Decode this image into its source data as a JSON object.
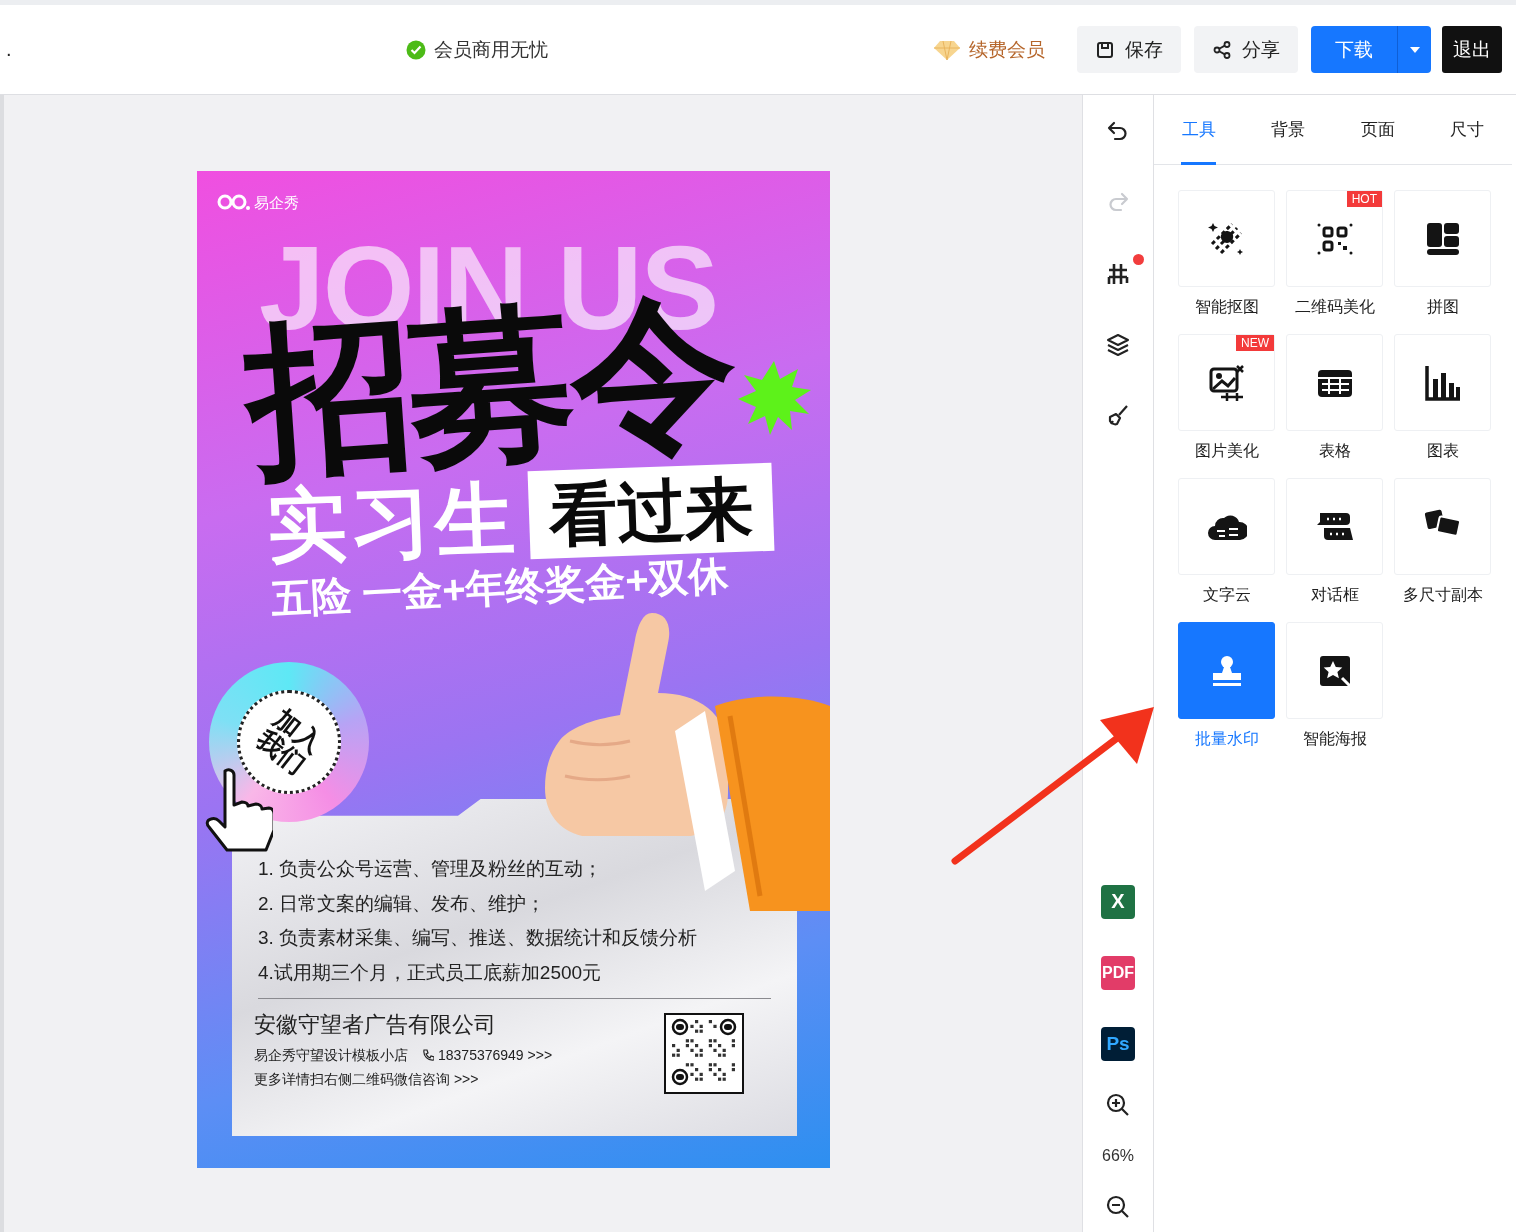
{
  "topbar": {
    "mark": ".",
    "member_note": "会员商用无忧",
    "renew": "续费会员",
    "actions": [
      {
        "kind": "save",
        "label": "保存"
      },
      {
        "kind": "share",
        "label": "分享"
      }
    ],
    "download": "下载",
    "exit": "退出"
  },
  "poster": {
    "brand": "易企秀",
    "bg_text": "JOIN US",
    "title": "招募令",
    "subtitle": "实习生",
    "tag": "看过来",
    "benefits": "五险 一金+年终奖金+双休",
    "badge": "加入我们",
    "duties": [
      "1. 负责公众号运营、管理及粉丝的互动；",
      "2. 日常文案的编辑、发布、维护；",
      "3. 负责素材采集、编写、推送、数据统计和反馈分析",
      "4.试用期三个月，正式员工底薪加2500元"
    ],
    "company": "安徽守望者广告有限公司",
    "shop": "易企秀守望设计模板小店",
    "phone": "18375376949 >>>",
    "note": "更多详情扫右侧二维码微信咨询 >>>"
  },
  "rail": {
    "tools": [
      {
        "kind": "undo",
        "disabled": false,
        "notice": false
      },
      {
        "kind": "redo",
        "disabled": true,
        "notice": false
      },
      {
        "kind": "grid",
        "disabled": false,
        "notice": true
      },
      {
        "kind": "layers",
        "disabled": false,
        "notice": false
      },
      {
        "kind": "brush",
        "disabled": false,
        "notice": false
      }
    ],
    "exports": [
      {
        "kind": "excel",
        "label": "X"
      },
      {
        "kind": "pdf",
        "label": "PDF"
      },
      {
        "kind": "ps",
        "label": "Ps"
      }
    ],
    "zoom": "66%"
  },
  "panel": {
    "tabs": [
      {
        "label": "工具",
        "selected": true
      },
      {
        "label": "背景",
        "selected": false
      },
      {
        "label": "页面",
        "selected": false
      },
      {
        "label": "尺寸",
        "selected": false
      }
    ],
    "tools": [
      {
        "kind": "cutout",
        "label": "智能抠图",
        "selected": false
      },
      {
        "kind": "qrcode",
        "label": "二维码美化",
        "badge": "HOT",
        "selected": false
      },
      {
        "kind": "collage",
        "label": "拼图",
        "selected": false
      },
      {
        "kind": "photo",
        "label": "图片美化",
        "badge": "NEW",
        "selected": false
      },
      {
        "kind": "table",
        "label": "表格",
        "selected": false
      },
      {
        "kind": "chart",
        "label": "图表",
        "selected": false
      },
      {
        "kind": "cloud",
        "label": "文字云",
        "selected": false
      },
      {
        "kind": "dialog",
        "label": "对话框",
        "selected": false
      },
      {
        "kind": "multisize",
        "label": "多尺寸副本",
        "selected": false
      },
      {
        "kind": "watermark",
        "label": "批量水印",
        "selected": true
      },
      {
        "kind": "poster",
        "label": "智能海报",
        "selected": false
      }
    ]
  }
}
